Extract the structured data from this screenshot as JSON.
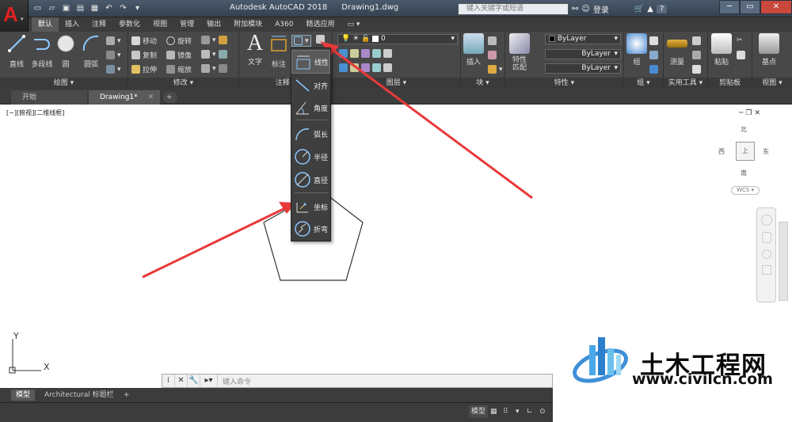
{
  "app": {
    "title": "Autodesk AutoCAD 2018",
    "filename": "Drawing1.dwg",
    "search_placeholder": "键入关键字或短语",
    "signin": "登录",
    "help_label": "?"
  },
  "ribbon_tabs": [
    "默认",
    "插入",
    "注释",
    "参数化",
    "视图",
    "管理",
    "输出",
    "附加模块",
    "A360",
    "精选应用"
  ],
  "draw_panel": {
    "title": "绘图 ▾",
    "line": "直线",
    "polyline": "多段线",
    "circle": "圆",
    "arc": "圆弧"
  },
  "modify_panel": {
    "title": "修改 ▾",
    "move": "移动",
    "rotate": "旋转",
    "copy": "复制",
    "mirror": "镜像",
    "stretch": "拉伸",
    "scale": "缩放"
  },
  "annotation_panel": {
    "title": "注释 ▾",
    "text": "文字",
    "dimension": "标注"
  },
  "layer_panel": {
    "title": "图层 ▾",
    "current_layer": "0"
  },
  "block_panel": {
    "title": "块 ▾",
    "insert": "插入"
  },
  "properties_panel": {
    "title": "特性 ▾",
    "match": "特性\n匹配",
    "color": "ByLayer",
    "linetype": "ByLayer",
    "lineweight": "ByLayer"
  },
  "group_panel": {
    "title": "组 ▾",
    "group": "组"
  },
  "utilities_panel": {
    "title": "实用工具 ▾",
    "measure": "测量"
  },
  "clipboard_panel": {
    "title": "剪贴板",
    "paste": "粘贴"
  },
  "view_panel": {
    "title": "视图 ▾",
    "base": "基点"
  },
  "dim_dropdown": {
    "items": [
      "线性",
      "对齐",
      "角度",
      "弧长",
      "半径",
      "直径",
      "坐标",
      "折弯"
    ]
  },
  "doc_tabs": [
    "开始",
    "Drawing1*"
  ],
  "viewport": {
    "label": "[−][俯视][二维线框]",
    "north": "北",
    "south": "南",
    "east": "东",
    "west": "西",
    "wcs": "WCS"
  },
  "ucs": {
    "x": "X",
    "y": "Y"
  },
  "command": {
    "placeholder": "键入命令"
  },
  "layout_tabs": [
    "模型",
    "Architectural 标题栏"
  ],
  "status": {
    "model": "模型"
  },
  "watermark": {
    "name": "土木工程网",
    "url": "www.civilcn.com"
  },
  "colors": {
    "arrow": "#e83a3a",
    "ribbon": "#484848",
    "accent_blue": "#3f8fd8"
  }
}
